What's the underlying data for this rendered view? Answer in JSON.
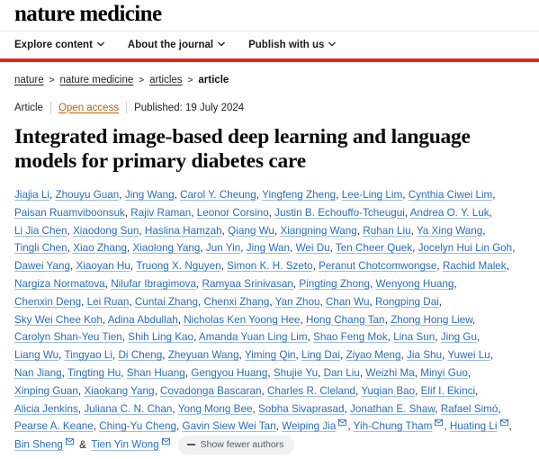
{
  "masthead": {
    "title": "nature medicine"
  },
  "nav": {
    "items": [
      {
        "label": "Explore content",
        "icon": "chevron-down-icon"
      },
      {
        "label": "About the journal",
        "icon": "chevron-down-icon"
      },
      {
        "label": "Publish with us",
        "icon": "chevron-down-icon"
      }
    ]
  },
  "colors": {
    "brand_red": "#e2231a",
    "link_blue": "#2a6ebb",
    "open_access_orange": "#b5640a",
    "pill_background": "#eff1f3"
  },
  "breadcrumb": {
    "items": [
      "nature",
      "nature medicine",
      "articles"
    ],
    "current": "article",
    "separator": ">"
  },
  "meta": {
    "type": "Article",
    "access_label": "Open access",
    "published": "Published: 19 July 2024"
  },
  "article": {
    "title": "Integrated image-based deep learning and language models for primary diabetes care"
  },
  "authors": {
    "list": [
      "Jiajia Li",
      "Zhouyu Guan",
      "Jing Wang",
      "Carol Y. Cheung",
      "Yingfeng Zheng",
      "Lee-Ling Lim",
      "Cynthia Ciwei Lim",
      "Paisan Ruamviboonsuk",
      "Rajiv Raman",
      "Leonor Corsino",
      "Justin B. Echouffo-Tcheugui",
      "Andrea O. Y. Luk",
      "Li Jia Chen",
      "Xiaodong Sun",
      "Haslina Hamzah",
      "Qiang Wu",
      "Xiangning Wang",
      "Ruhan Liu",
      "Ya Xing Wang",
      "Tingli Chen",
      "Xiao Zhang",
      "Xiaolong Yang",
      "Jun Yin",
      "Jing Wan",
      "Wei Du",
      "Ten Cheer Quek",
      "Jocelyn Hui Lin Goh",
      "Dawei Yang",
      "Xiaoyan Hu",
      "Truong X. Nguyen",
      "Simon K. H. Szeto",
      "Peranut Chotcomwongse",
      "Rachid Malek",
      "Nargiza Normatova",
      "Nilufar Ibragimova",
      "Ramyaa Srinivasan",
      "Pingting Zhong",
      "Wenyong Huang",
      "Chenxin Deng",
      "Lei Ruan",
      "Cuntai Zhang",
      "Chenxi Zhang",
      "Yan Zhou",
      "Chan Wu",
      "Rongping Dai",
      "Sky Wei Chee Koh",
      "Adina Abdullah",
      "Nicholas Ken Yoong Hee",
      "Hong Chang Tan",
      "Zhong Hong Liew",
      "Carolyn Shan-Yeu Tien",
      "Shih Ling Kao",
      "Amanda Yuan Ling Lim",
      "Shao Feng Mok",
      "Lina Sun",
      "Jing Gu",
      "Liang Wu",
      "Tingyao Li",
      "Di Cheng",
      "Zheyuan Wang",
      "Yiming Qin",
      "Ling Dai",
      "Ziyao Meng",
      "Jia Shu",
      "Yuwei Lu",
      "Nan Jiang",
      "Tingting Hu",
      "Shan Huang",
      "Gengyou Huang",
      "Shujie Yu",
      "Dan Liu",
      "Weizhi Ma",
      "Minyi Guo",
      "Xinping Guan",
      "Xiaokang Yang",
      "Covadonga Bascaran",
      "Charles R. Cleland",
      "Yuqian Bao",
      "Elif I. Ekinci",
      "Alicia Jenkins",
      "Juliana C. N. Chan",
      "Yong Mong Bee",
      "Sobha Sivaprasad",
      "Jonathan E. Shaw",
      "Rafael Simó",
      "Pearse A. Keane",
      "Ching-Yu Cheng",
      "Gavin Siew Wei Tan",
      "Weiping Jia",
      "Yih-Chung Tham",
      "Huating Li",
      "Bin Sheng",
      "Tien Yin Wong"
    ],
    "corresponding": [
      "Weiping Jia",
      "Yih-Chung Tham",
      "Huating Li",
      "Bin Sheng",
      "Tien Yin Wong"
    ],
    "ampersand": "&",
    "mail_icon": "envelope-icon",
    "show_fewer_label": "Show fewer authors",
    "show_fewer_icon": "minus-icon"
  }
}
